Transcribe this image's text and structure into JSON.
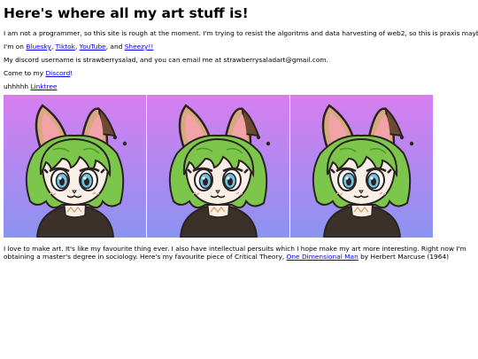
{
  "page": {
    "title": "Here's where all my art stuff is!",
    "intro": "I am not a programmer, so this site is rough at the moment. I'm trying to resist the algoritms and data harvesting of web2, so this is praxis maybe",
    "socials": {
      "prefix": "I'm on ",
      "bluesky": "Bluesky",
      "sep1": ", ",
      "tiktok": "Tiktok",
      "sep2": ", ",
      "youtube": "YouTube",
      "sep3": ", and ",
      "sheezy": "Sheezy!!"
    },
    "contact": "My discord username is strawberrysalad, and you can email me at strawberrysaladart@gmail.com.",
    "discord": {
      "prefix": "Come to my ",
      "link": "Discord",
      "suffix": "!"
    },
    "linktree": {
      "prefix": "uhhhhh ",
      "link": "Linktree"
    },
    "about": {
      "text": "I love to make art. It's like my favourite thing ever. I also have intellectual persuits which I hope make my art more interesting. Right now I'm obtaining a master's degree in sociology. Here's my favourite piece of Critical Theory, ",
      "link": "One Dimensional Man",
      "suffix": " by Herbert Marcuse (1964)"
    }
  },
  "colors": {
    "gradient_top": "#d77ef0",
    "gradient_bottom": "#8b93f0",
    "hair": "#7cc64c",
    "hair_dark": "#4f9a32",
    "ear_tan": "#d8a880",
    "ear_brown": "#6e4a32",
    "ear_inner": "#f2a3a8",
    "skin": "#f8efe6",
    "eye": "#6ec3ea",
    "shirt": "#3c312a",
    "outline": "#2b2320"
  }
}
